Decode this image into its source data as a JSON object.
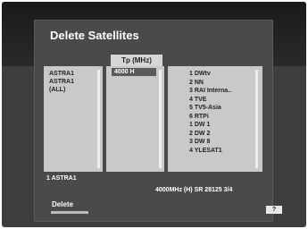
{
  "title": "Delete Satellites",
  "tp_header": "Tp (MHz)",
  "satellites": [
    "ASTRA1",
    "ASTRA1",
    "(ALL)"
  ],
  "transponder_selected": "4000  H",
  "services": [
    "1 DWtv",
    "2 NN",
    "3 RAI Interna..",
    "4 TVE",
    "5 TV5-Asia",
    "6 RTPi",
    "1 DW 1",
    "2 DW 2",
    "3 DW 8",
    "4 YLESAT1"
  ],
  "status_left": "1 ASTRA1",
  "status_right": "4000MHz (H) SR 28125 3/4",
  "delete_label": "Delete",
  "help_key": "?"
}
